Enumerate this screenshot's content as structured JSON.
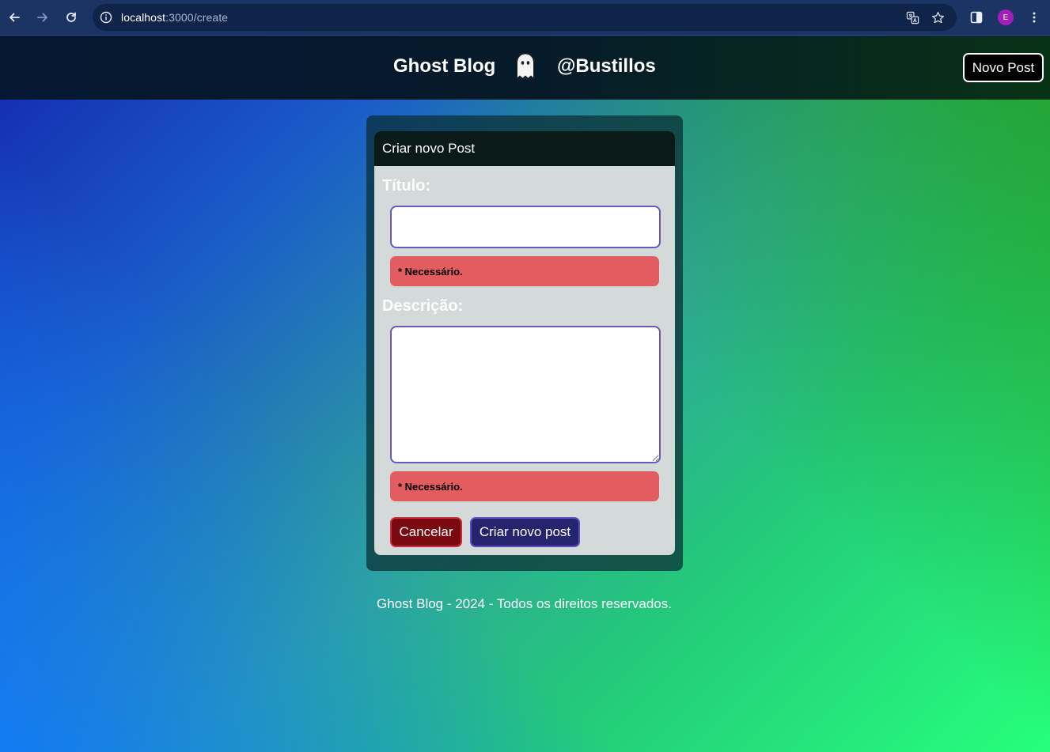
{
  "browser": {
    "url_host": "localhost",
    "url_path": ":3000/create",
    "profile_initial": "E"
  },
  "header": {
    "brand": "Ghost Blog",
    "handle": "@Bustillos",
    "new_post_button": "Novo Post"
  },
  "form": {
    "card_title": "Criar novo Post",
    "title_label": "Título:",
    "title_value": "",
    "title_error": "* Necessário.",
    "description_label": "Descrição:",
    "description_value": "",
    "description_error": "* Necessário.",
    "cancel_button": "Cancelar",
    "submit_button": "Criar novo post"
  },
  "footer": {
    "text": "Ghost Blog - 2024 - Todos os direitos reservados."
  },
  "colors": {
    "error_bg": "#e25c60",
    "cancel_bg": "#7a0a10",
    "submit_bg": "#24256e",
    "input_border": "#6a59b8"
  },
  "icons": {
    "back": "arrow-left-icon",
    "forward": "arrow-right-icon",
    "reload": "reload-icon",
    "site_info": "info-icon",
    "translate": "translate-icon",
    "bookmark": "star-icon",
    "side_panel": "side-panel-icon",
    "menu": "kebab-menu-icon",
    "logo": "ghost-icon"
  }
}
